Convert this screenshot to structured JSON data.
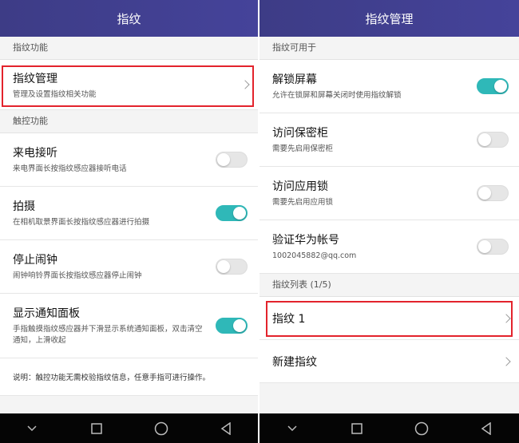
{
  "left": {
    "title": "指纹",
    "section1": "指纹功能",
    "manage": {
      "title": "指纹管理",
      "sub": "管理及设置指纹相关功能"
    },
    "section2": "触控功能",
    "items": [
      {
        "title": "来电接听",
        "sub": "来电界面长按指纹感应器接听电话",
        "on": false
      },
      {
        "title": "拍摄",
        "sub": "在相机取景界面长按指纹感应器进行拍摄",
        "on": true
      },
      {
        "title": "停止闹钟",
        "sub": "闹钟响铃界面长按指纹感应器停止闹钟",
        "on": false
      },
      {
        "title": "显示通知面板",
        "sub": "手指触摸指纹感应器并下滑显示系统通知面板，双击清空通知，上滑收起",
        "on": true
      }
    ],
    "note": "说明：触控功能无需校验指纹信息，任意手指可进行操作。"
  },
  "right": {
    "title": "指纹管理",
    "section1": "指纹可用于",
    "items": [
      {
        "title": "解锁屏幕",
        "sub": "允许在锁屏和屏幕关闭时使用指纹解锁",
        "on": true
      },
      {
        "title": "访问保密柜",
        "sub": "需要先启用保密柜",
        "on": false
      },
      {
        "title": "访问应用锁",
        "sub": "需要先启用应用锁",
        "on": false
      },
      {
        "title": "验证华为帐号",
        "sub": "1002045882@qq.com",
        "on": false
      }
    ],
    "section2": "指纹列表 (1/5)",
    "fingerprint1": "指纹 1",
    "new_fingerprint": "新建指纹"
  },
  "colors": {
    "accent": "#2fb8b8",
    "header": "#3d3c86",
    "highlight": "#e3232c"
  },
  "icons": {
    "back": "back-triangle-icon",
    "home": "home-circle-icon",
    "recent": "recent-square-icon",
    "down": "chevron-down-icon"
  }
}
